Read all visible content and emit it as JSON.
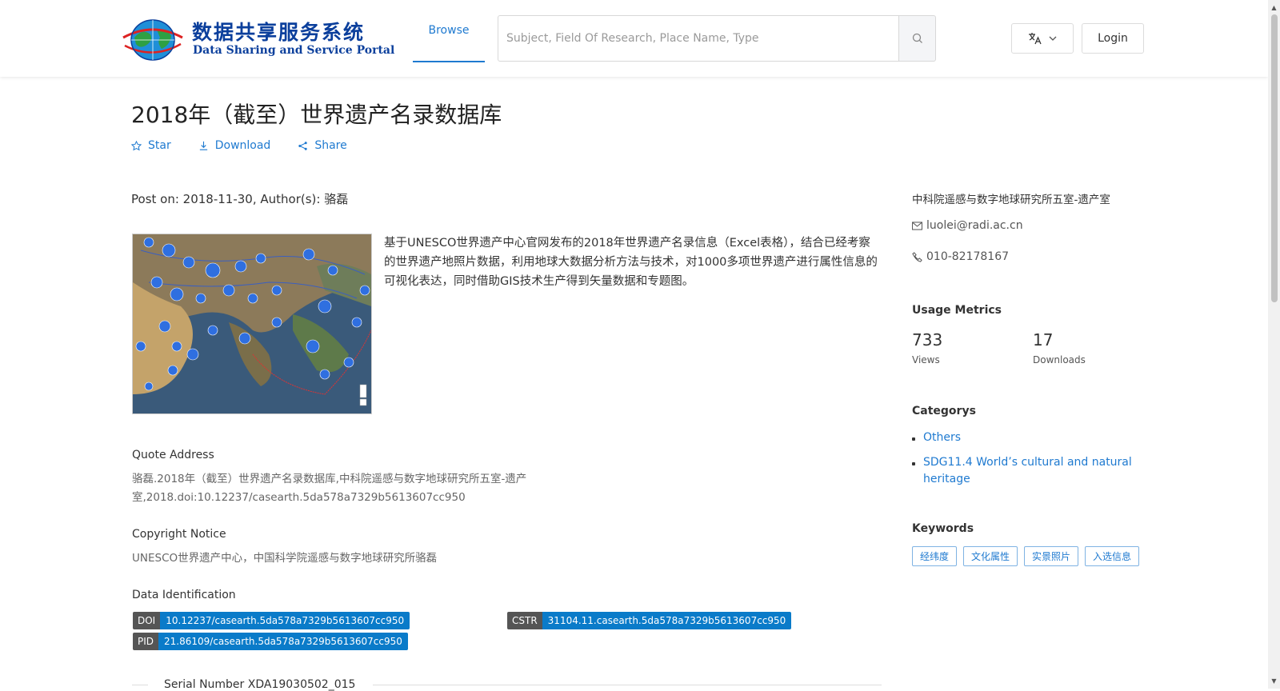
{
  "header": {
    "logo": {
      "title_cn": "数据共享服务系统",
      "title_en": "Data Sharing and Service Portal"
    },
    "nav_browse": "Browse",
    "search_placeholder": "Subject, Field Of Research, Place Name, Type",
    "login_label": "Login"
  },
  "dataset": {
    "title": "2018年（截至）世界遗产名录数据库",
    "actions": {
      "star": "Star",
      "download": "Download",
      "share": "Share"
    },
    "post_meta": "Post on: 2018-11-30, Author(s): 骆磊",
    "abstract": "基于UNESCO世界遗产中心官网发布的2018年世界遗产名录信息（Excel表格），结合已经考察的世界遗产地照片数据，利用地球大数据分析方法与技术，对1000多项世界遗产进行属性信息的可视化表达，同时借助GIS技术生产得到矢量数据和专题图。",
    "quote": {
      "title": "Quote Address",
      "text": "骆磊.2018年（截至）世界遗产名录数据库,中科院遥感与数字地球研究所五室-遗产室,2018.doi:10.12237/casearth.5da578a7329b5613607cc950"
    },
    "copyright": {
      "title": "Copyright Notice",
      "text": "UNESCO世界遗产中心，中国科学院遥感与数字地球研究所骆磊"
    },
    "identification": {
      "title": "Data Identification",
      "doi_key": "DOI",
      "doi_value": "10.12237/casearth.5da578a7329b5613607cc950",
      "cstr_key": "CSTR",
      "cstr_value": "31104.11.casearth.5da578a7329b5613607cc950",
      "pid_key": "PID",
      "pid_value": "21.86109/casearth.5da578a7329b5613607cc950"
    },
    "serial_number": "Serial Number XDA19030502_015"
  },
  "sidebar": {
    "organization": "中科院遥感与数字地球研究所五室-遗产室",
    "email": "luolei@radi.ac.cn",
    "phone": "010-82178167",
    "usage_title": "Usage Metrics",
    "views_count": "733",
    "views_label": "Views",
    "downloads_count": "17",
    "downloads_label": "Downloads",
    "categories_title": "Categorys",
    "categories": [
      "Others",
      "SDG11.4 World’s cultural and natural heritage"
    ],
    "keywords_title": "Keywords",
    "keywords": [
      "经纬度",
      "文化属性",
      "实景照片",
      "入选信息"
    ]
  },
  "colors": {
    "accent": "#1f7ad0",
    "badge_key": "#555555",
    "badge_value": "#0a7bc9"
  },
  "icons": [
    "globe-logo-icon",
    "search-icon",
    "translate-icon",
    "chevron-down-icon",
    "star-icon",
    "download-icon",
    "share-icon",
    "mail-icon",
    "phone-icon"
  ]
}
